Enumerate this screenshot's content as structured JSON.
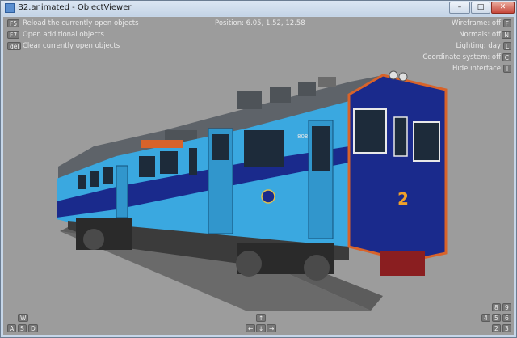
{
  "window": {
    "title": "B2.animated - ObjectViewer",
    "minimize": "–",
    "maximize": "□",
    "close": "✕"
  },
  "overlay": {
    "left": [
      {
        "key": "F5",
        "label": "Reload the currently open objects"
      },
      {
        "key": "F7",
        "label": "Open additional objects"
      },
      {
        "key": "del",
        "label": "Clear currently open objects"
      }
    ],
    "position_label": "Position: 6.05, 1.52, 12.58",
    "right": [
      {
        "key": "F",
        "label": "Wireframe: off"
      },
      {
        "key": "N",
        "label": "Normals: off"
      },
      {
        "key": "L",
        "label": "Lighting: day"
      },
      {
        "key": "C",
        "label": "Coordinate system: off"
      },
      {
        "key": "I",
        "label": "Hide interface"
      }
    ]
  },
  "nav": {
    "left": {
      "top": "W",
      "bottom": [
        "A",
        "S",
        "D"
      ]
    },
    "center": {
      "top": "↑",
      "bottom": [
        "←",
        "↓",
        "→"
      ]
    },
    "right": {
      "rows": [
        [
          "8",
          "9"
        ],
        [
          "4",
          "5",
          "6"
        ],
        [
          "2",
          "3"
        ]
      ]
    }
  },
  "train": {
    "number": "2",
    "side_code": "808",
    "body_color": "#3aa8e0",
    "stripe_color": "#1a2a8c",
    "accent_color": "#d8632a",
    "floor_color": "#6a6a6a",
    "background_color": "#9c9c9c"
  }
}
